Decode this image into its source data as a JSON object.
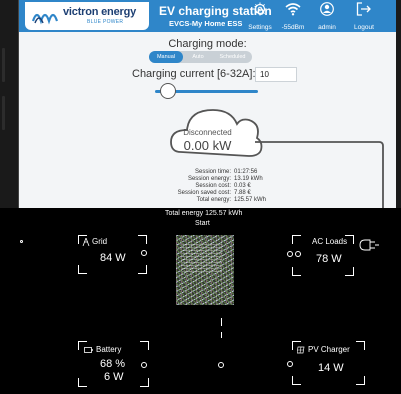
{
  "header": {
    "logo_text": "victron energy",
    "logo_sub": "BLUE POWER",
    "title": "EV charging station",
    "subtitle": "EVCS-My Home ESS",
    "settings_label": "Settings",
    "signal_label": "-55dBm",
    "user_label": "admin",
    "logout_label": "Logout"
  },
  "charging": {
    "mode_title": "Charging mode:",
    "modes": [
      "Manual",
      "Auto",
      "Scheduled"
    ],
    "current_label": "Charging current [6-32A]:",
    "current_value": "10",
    "slider_fraction": 0.125,
    "status_text": "Disconnected",
    "power": "0.00 kW"
  },
  "session": [
    {
      "k": "Session time:",
      "v": "01:27:56"
    },
    {
      "k": "Session energy:",
      "v": "13.19 kWh"
    },
    {
      "k": "Session cost:",
      "v": "0.03 €"
    },
    {
      "k": "Session saved cost:",
      "v": "7.88 €"
    },
    {
      "k": "Total energy:",
      "v": "125.57 kWh"
    }
  ],
  "overview": {
    "total_energy": "Total energy 125.57 kWh",
    "start": "Start",
    "grid_label": "Grid",
    "grid_value": "84 W",
    "ac_loads_label": "AC Loads",
    "ac_loads_value": "78 W",
    "battery_label": "Battery",
    "battery_soc": "68 %",
    "battery_power": "6 W",
    "pv_label": "PV Charger",
    "pv_value": "14 W"
  },
  "colors": {
    "accent": "#2f86c9",
    "logo_dark": "#1d3f73",
    "background": "#f3f5f7"
  }
}
